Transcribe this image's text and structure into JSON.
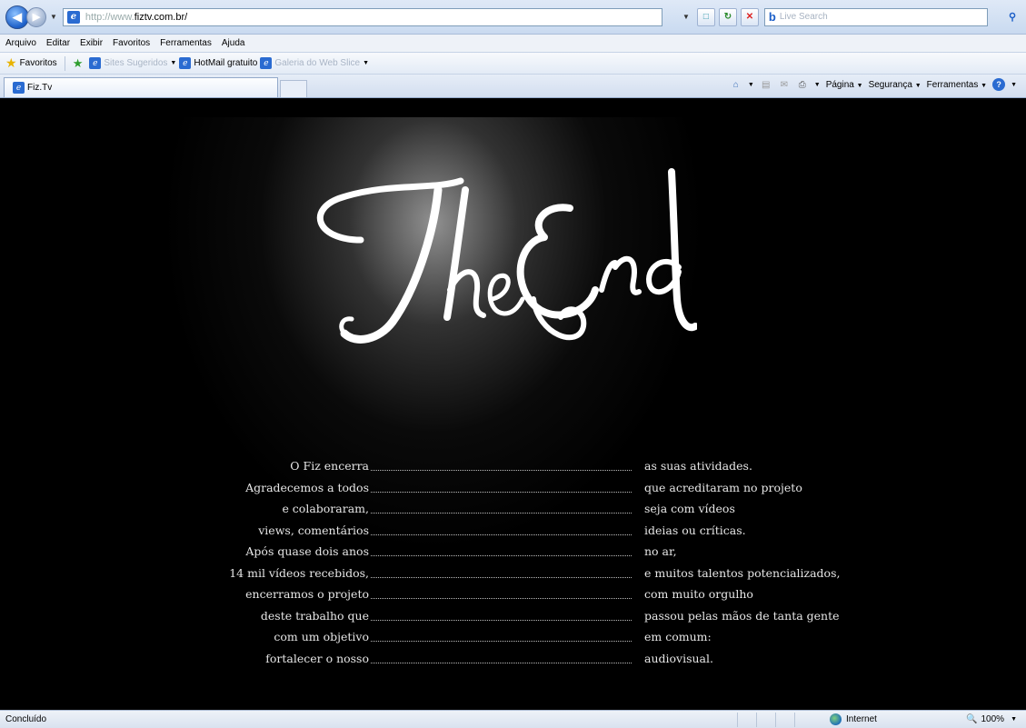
{
  "browser": {
    "address": {
      "url_prefix": "http://www.",
      "url_host": "fiztv.com.br/"
    },
    "search": {
      "placeholder": "Live Search"
    },
    "menu": [
      "Arquivo",
      "Editar",
      "Exibir",
      "Favoritos",
      "Ferramentas",
      "Ajuda"
    ],
    "favorites_bar": {
      "favorites_label": "Favoritos",
      "items": [
        {
          "label": "Sites Sugeridos",
          "dim": true
        },
        {
          "label": "HotMail gratuito",
          "dim": false
        },
        {
          "label": "Galeria do Web Slice",
          "dim": true
        }
      ]
    },
    "tab": {
      "title": "Fiz.Tv"
    },
    "commands": {
      "page": "Página",
      "safety": "Segurança",
      "tools": "Ferramentas"
    },
    "status": {
      "text": "Concluído",
      "zone": "Internet",
      "zoom": "100%"
    }
  },
  "page": {
    "logo_text": "The End",
    "credits": [
      {
        "left": "O Fiz encerra",
        "right": "as suas atividades."
      },
      {
        "left": "Agradecemos a todos",
        "right": "que acreditaram no projeto"
      },
      {
        "left": "e colaboraram,",
        "right": "seja com vídeos"
      },
      {
        "left": "views, comentários",
        "right": "ideias ou críticas."
      },
      {
        "left": "Após quase dois anos",
        "right": "no ar,"
      },
      {
        "left": "14 mil vídeos recebidos,",
        "right": "e muitos talentos potencializados,"
      },
      {
        "left": "encerramos o projeto",
        "right": "com muito orgulho"
      },
      {
        "left": "deste trabalho que",
        "right": "passou pelas mãos de tanta gente"
      },
      {
        "left": "com um objetivo",
        "right": "em comum:"
      },
      {
        "left": "fortalecer o nosso",
        "right": "audiovisual."
      }
    ]
  }
}
